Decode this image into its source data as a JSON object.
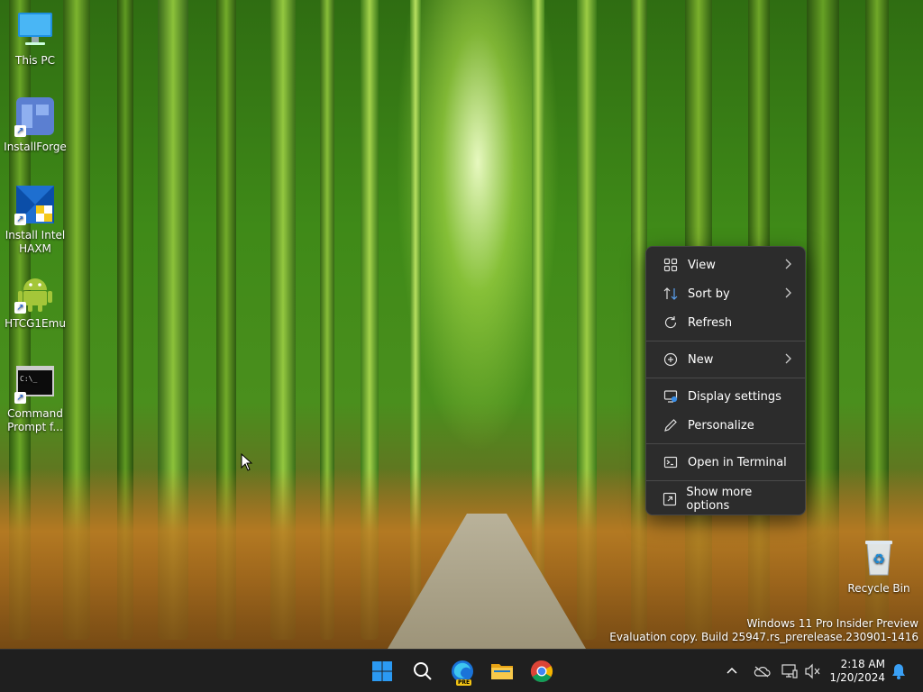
{
  "desktop": {
    "icons": [
      {
        "label": "This PC",
        "icon": "computer-icon"
      },
      {
        "label": "InstallForge",
        "icon": "installforge-icon"
      },
      {
        "label": "Install Intel HAXM",
        "icon": "haxm-installer-icon"
      },
      {
        "label": "HTCG1Emu",
        "icon": "android-icon"
      },
      {
        "label": "Command Prompt f...",
        "icon": "command-prompt-icon"
      },
      {
        "label": "Recycle Bin",
        "icon": "recycle-bin-icon"
      }
    ],
    "cmd_glyph": "C:\\_"
  },
  "context_menu": {
    "items": [
      {
        "label": "View",
        "icon": "view-grid-icon",
        "submenu": true
      },
      {
        "label": "Sort by",
        "icon": "sort-icon",
        "submenu": true
      },
      {
        "label": "Refresh",
        "icon": "refresh-icon",
        "submenu": false
      },
      {
        "label": "New",
        "icon": "new-plus-icon",
        "submenu": true
      },
      {
        "label": "Display settings",
        "icon": "display-settings-icon",
        "submenu": false
      },
      {
        "label": "Personalize",
        "icon": "pen-icon",
        "submenu": false
      },
      {
        "label": "Open in Terminal",
        "icon": "terminal-icon",
        "submenu": false
      },
      {
        "label": "Show more options",
        "icon": "more-options-icon",
        "submenu": false
      }
    ]
  },
  "watermark": {
    "line1": "Windows 11 Pro Insider Preview",
    "line2": "Evaluation copy. Build 25947.rs_prerelease.230901-1416"
  },
  "taskbar": {
    "apps": [
      {
        "name": "Start",
        "icon": "windows-start-icon"
      },
      {
        "name": "Search",
        "icon": "search-icon"
      },
      {
        "name": "Microsoft Edge Canary",
        "icon": "edge-pre-icon",
        "badge": "PRE"
      },
      {
        "name": "File Explorer",
        "icon": "folder-icon"
      },
      {
        "name": "Google Chrome",
        "icon": "chrome-icon"
      }
    ],
    "tray": [
      "chevron-up-icon",
      "onedrive-icon",
      "network-icon",
      "volume-muted-icon"
    ],
    "time": "2:18 AM",
    "date": "1/20/2024",
    "notification_icon": "bell-icon"
  },
  "colors": {
    "menu_bg": "#2c2c2c",
    "taskbar_bg": "#1f1f1f",
    "accent_blue": "#0078d4"
  }
}
